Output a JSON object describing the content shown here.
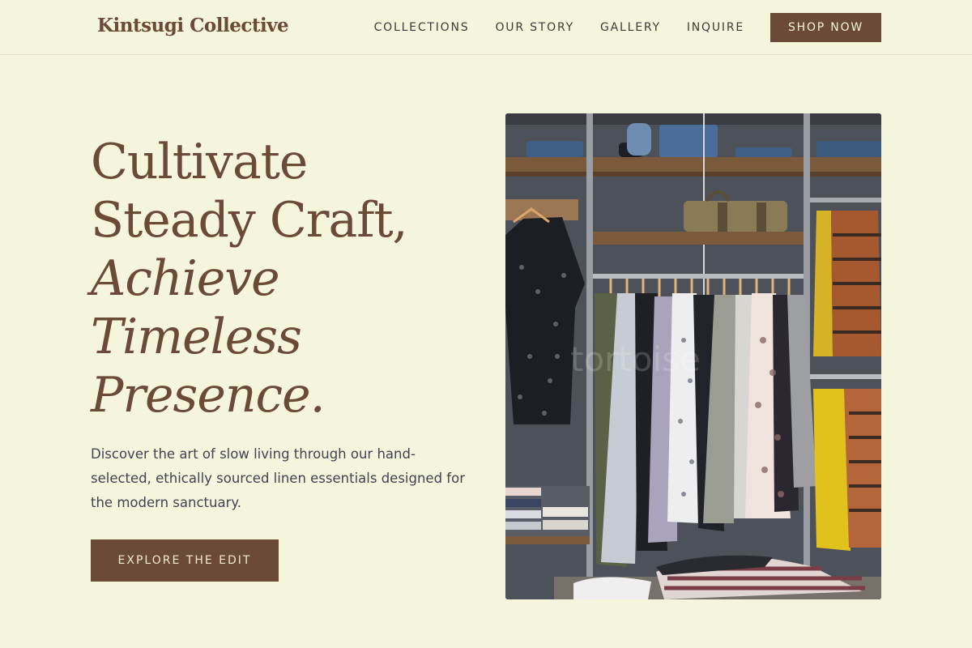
{
  "header": {
    "brand": "Kintsugi Collective",
    "nav": [
      {
        "label": "COLLECTIONS"
      },
      {
        "label": "OUR STORY"
      },
      {
        "label": "GALLERY"
      },
      {
        "label": "INQUIRE"
      }
    ],
    "cta_label": "SHOP NOW"
  },
  "hero": {
    "headline": {
      "line1": "Cultivate",
      "line2": "Steady Craft,",
      "line3": "Achieve",
      "line4": "Timeless",
      "line5": "Presence."
    },
    "description": "Discover the art of slow living through our hand-selected, ethically sourced linen essentials designed for the modern sanctuary.",
    "button_label": "EXPLORE THE EDIT"
  },
  "image": {
    "watermark": "tortoise"
  },
  "colors": {
    "background": "#f5f4dc",
    "accent": "#6b4a37",
    "text": "#3f4450"
  }
}
